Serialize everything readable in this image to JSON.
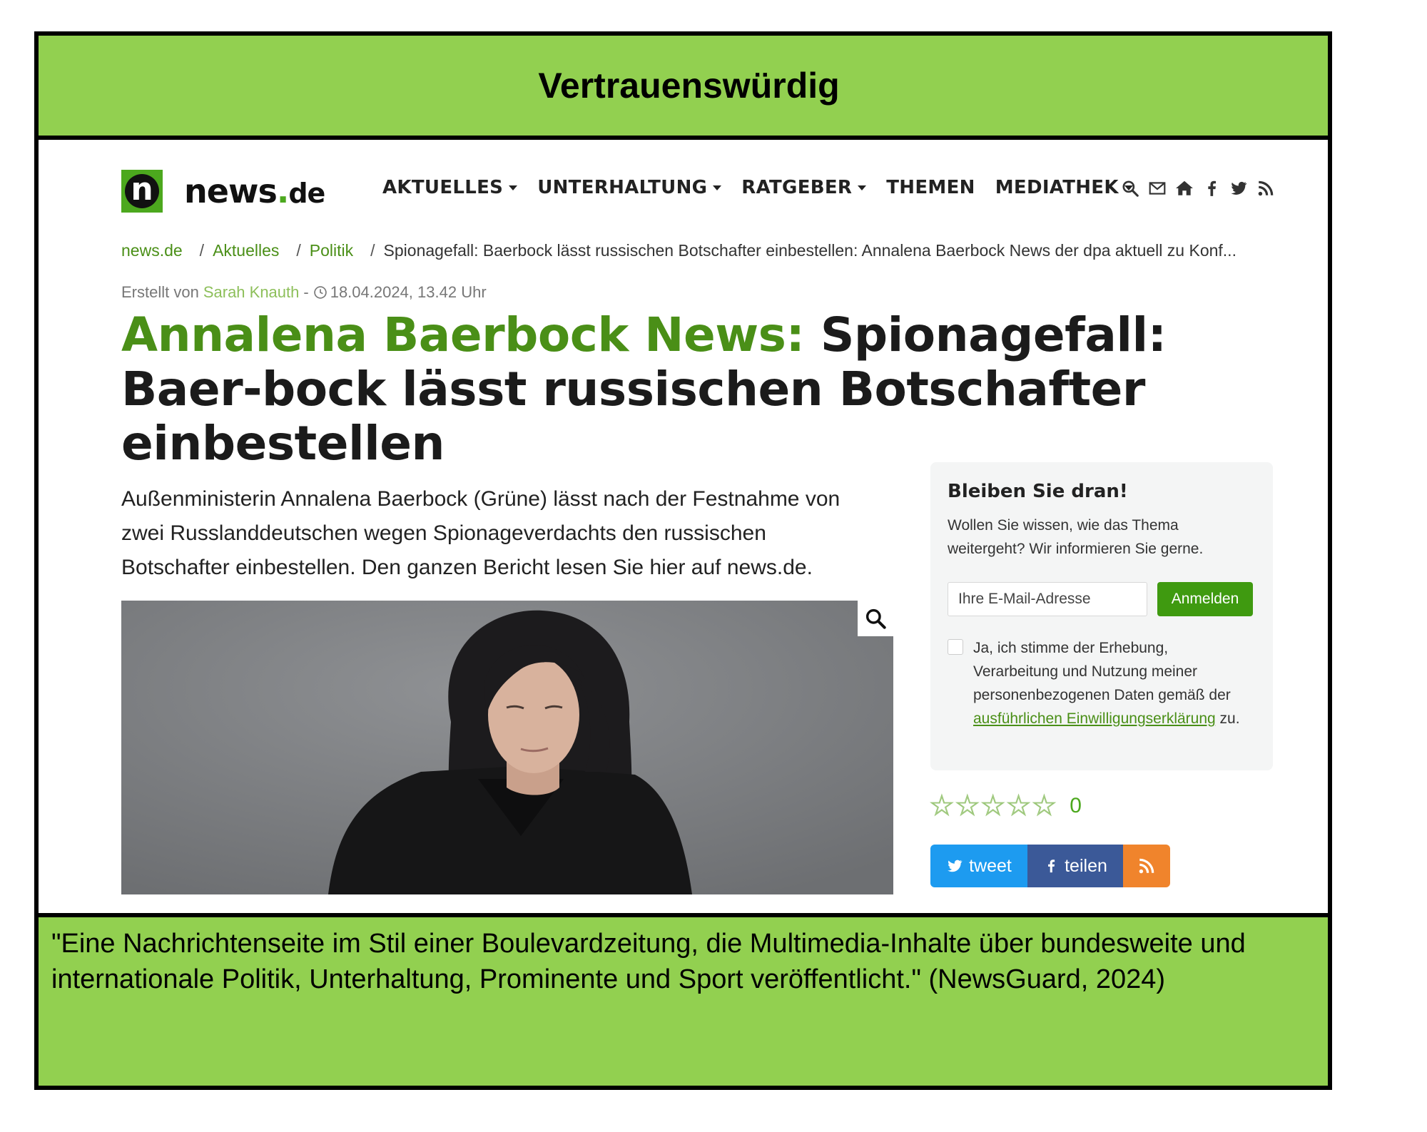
{
  "banner": {
    "rating_label": "Vertrauenswürdig",
    "description": "\"Eine Nachrichtenseite im Stil einer Boulevardzeitung, die Multimedia-Inhalte über bundesweite und internationale Politik, Unterhaltung, Prominente und Sport veröffentlicht.\" (NewsGuard, 2024)"
  },
  "site": {
    "logo": {
      "letter": "n",
      "name": "news",
      "dot": ".",
      "tld": "de"
    },
    "nav": {
      "items": [
        {
          "label": "AKTUELLES",
          "dropdown": true
        },
        {
          "label": "UNTERHALTUNG",
          "dropdown": true
        },
        {
          "label": "RATGEBER",
          "dropdown": true
        },
        {
          "label": "THEMEN",
          "dropdown": false
        },
        {
          "label": "MEDIATHEK",
          "dropdown": true
        }
      ],
      "icons": [
        "search-icon",
        "mail-icon",
        "home-icon",
        "facebook-icon",
        "twitter-icon",
        "rss-icon"
      ]
    },
    "breadcrumb": {
      "items": [
        "news.de",
        "Aktuelles",
        "Politik"
      ],
      "current": "Spionagefall: Baerbock lässt russischen Botschafter einbestellen: Annalena Baerbock News der dpa aktuell zu Konf..."
    },
    "byline": {
      "prefix": "Erstellt von",
      "author": "Sarah Knauth",
      "dash": "-",
      "date": "18.04.2024, 13.42 Uhr"
    },
    "headline": {
      "kicker": "Annalena Baerbock News:",
      "title": "Spionagefall: Baer-bock lässt russischen Botschafter einbestellen"
    },
    "lead": "Außenministerin Annalena Baerbock (Grüne) lässt nach der Festnahme von zwei Russlanddeutschen wegen Spionageverdachts den russischen Botschafter einbestellen. Den ganzen Bericht lesen Sie hier auf news.de.",
    "newsletter": {
      "title": "Bleiben Sie dran!",
      "text": "Wollen Sie wissen, wie das Thema weitergeht? Wir informieren Sie gerne.",
      "email_placeholder": "Ihre E-Mail-Adresse",
      "submit_label": "Anmelden",
      "consent_prefix": "Ja, ich stimme der Erhebung, Verarbeitung und Nutzung meiner personenbezogenen Daten gemäß der",
      "consent_link": "ausführlichen Einwilligungserklärung",
      "consent_suffix": "zu."
    },
    "rating": {
      "stars": 5,
      "count": "0"
    },
    "share": {
      "tweet_label": "tweet",
      "facebook_label": "teilen"
    },
    "colors": {
      "brand_green": "#4ca81e",
      "banner_green": "#92d050",
      "twitter": "#1d9bf0",
      "facebook": "#3b5998",
      "rss": "#f0842c"
    }
  }
}
